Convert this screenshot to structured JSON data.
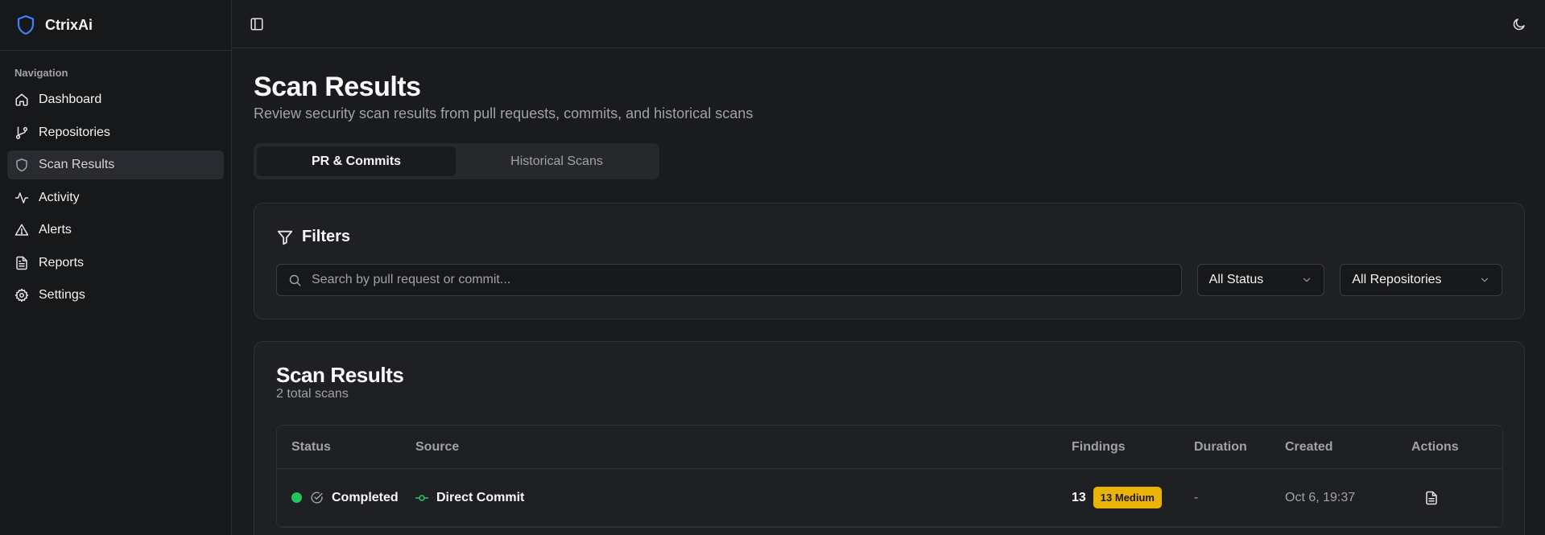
{
  "app": {
    "name": "CtrixAi"
  },
  "sidebar": {
    "section_label": "Navigation",
    "items": [
      {
        "label": "Dashboard",
        "icon": "home-icon"
      },
      {
        "label": "Repositories",
        "icon": "git-branch-icon"
      },
      {
        "label": "Scan Results",
        "icon": "shield-icon",
        "active": true
      },
      {
        "label": "Activity",
        "icon": "activity-icon"
      },
      {
        "label": "Alerts",
        "icon": "alert-triangle-icon"
      },
      {
        "label": "Reports",
        "icon": "file-text-icon"
      },
      {
        "label": "Settings",
        "icon": "gear-icon"
      }
    ]
  },
  "page": {
    "title": "Scan Results",
    "subtitle": "Review security scan results from pull requests, commits, and historical scans"
  },
  "tabs": [
    {
      "label": "PR & Commits",
      "active": true
    },
    {
      "label": "Historical Scans",
      "active": false
    }
  ],
  "filters": {
    "title": "Filters",
    "search_placeholder": "Search by pull request or commit...",
    "search_value": "",
    "status_selected": "All Status",
    "repo_selected": "All Repositories"
  },
  "results": {
    "title": "Scan Results",
    "count": "2 total scans",
    "columns": [
      "Status",
      "Source",
      "Findings",
      "Duration",
      "Created",
      "Actions"
    ],
    "rows": [
      {
        "status": "Completed",
        "source": "Direct Commit",
        "findings": "13",
        "badge": "13 Medium",
        "duration": "-",
        "created": "Oct 6, 19:37"
      }
    ]
  },
  "colors": {
    "accent": "#3b82f6",
    "status_ok": "#22c55e",
    "badge_medium": "#eab308",
    "background": "#1a1b1e",
    "sidebar": "#17181a"
  }
}
